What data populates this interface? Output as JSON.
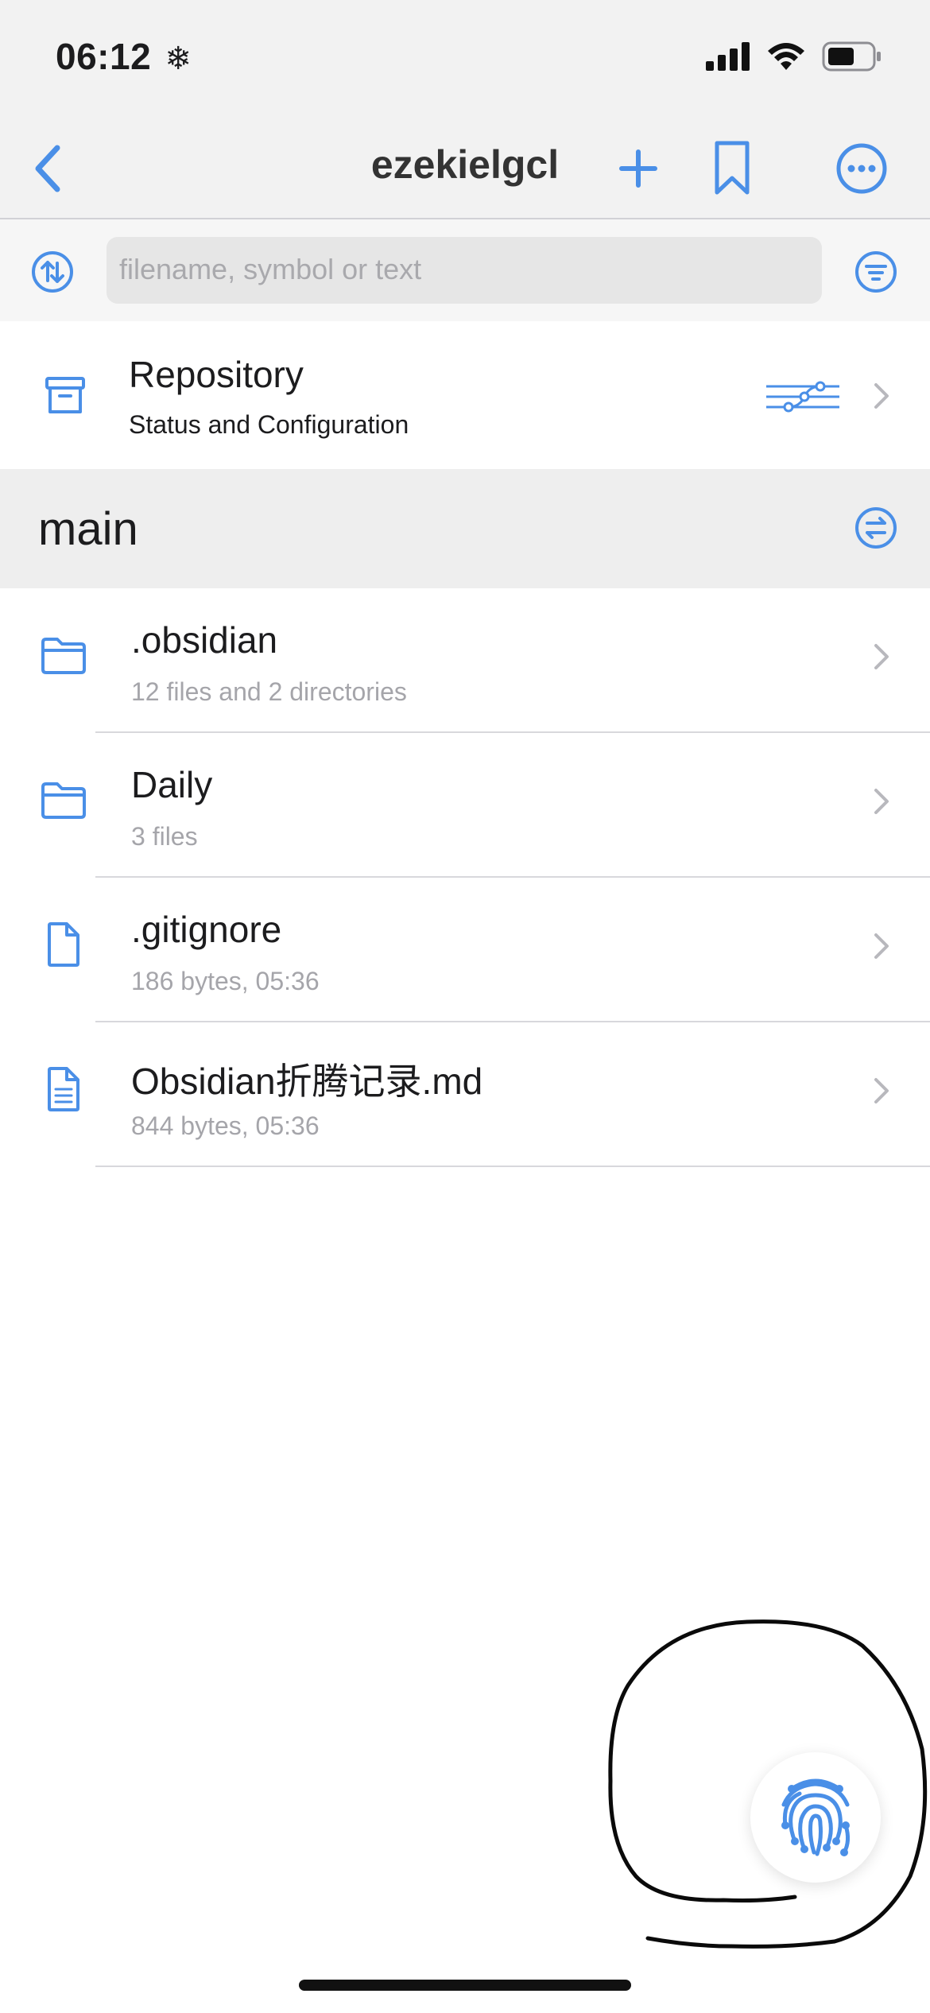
{
  "status_bar": {
    "time": "06:12",
    "icons": [
      "snowflake-icon",
      "cellular-signal-icon",
      "wifi-icon",
      "battery-icon"
    ]
  },
  "nav": {
    "title": "ezekielgcl",
    "icons": [
      "back-chevron-icon",
      "plus-icon",
      "bookmark-icon",
      "more-icon"
    ]
  },
  "search": {
    "placeholder": "filename, symbol or text",
    "icons": [
      "sort-icon",
      "filter-icon"
    ]
  },
  "repository": {
    "title": "Repository",
    "subtitle": "Status and Configuration",
    "icons": [
      "archive-box-icon",
      "git-graph-icon",
      "chevron-right-icon"
    ]
  },
  "branch": {
    "name": "main",
    "icons": [
      "switch-branch-icon"
    ]
  },
  "files": [
    {
      "name": ".obsidian",
      "detail": "12 files and 2 directories",
      "icon": "folder-icon"
    },
    {
      "name": "Daily",
      "detail": "3 files",
      "icon": "folder-icon"
    },
    {
      "name": ".gitignore",
      "detail": "186 bytes, 05:36",
      "icon": "file-icon"
    },
    {
      "name": "Obsidian折腾记录.md",
      "detail": "844 bytes, 05:36",
      "icon": "document-text-icon"
    }
  ],
  "floating": {
    "icon": "fingerprint-icon"
  },
  "colors": {
    "accent": "#4a8fe7",
    "background": "#f2f2f2",
    "secondary_text": "#a5a5aa"
  }
}
